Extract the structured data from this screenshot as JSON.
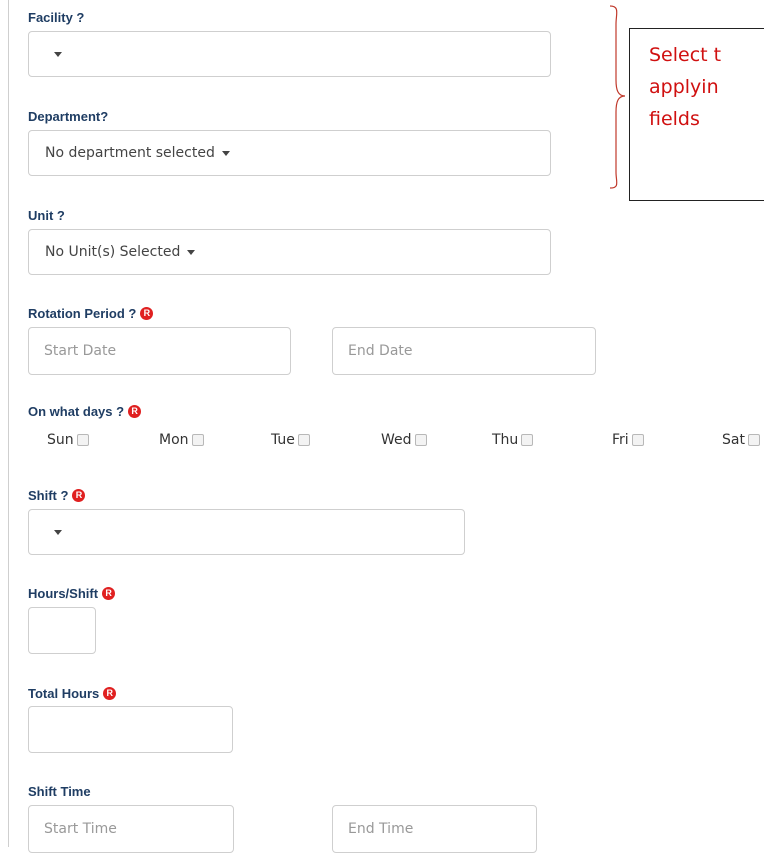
{
  "facility": {
    "label": "Facility ?",
    "selected": ""
  },
  "department": {
    "label": "Department?",
    "selected": "No department selected"
  },
  "unit": {
    "label": "Unit ?",
    "selected": "No Unit(s) Selected"
  },
  "rotation": {
    "label": "Rotation Period ?",
    "start_placeholder": "Start Date",
    "end_placeholder": "End Date"
  },
  "days": {
    "label": "On what days ?",
    "items": [
      {
        "label": "Sun",
        "checked": false
      },
      {
        "label": "Mon",
        "checked": false
      },
      {
        "label": "Tue",
        "checked": false
      },
      {
        "label": "Wed",
        "checked": false
      },
      {
        "label": "Thu",
        "checked": false
      },
      {
        "label": "Fri",
        "checked": false
      },
      {
        "label": "Sat",
        "checked": false
      }
    ]
  },
  "shift": {
    "label": "Shift ?",
    "selected": ""
  },
  "hours_shift": {
    "label": "Hours/Shift",
    "value": ""
  },
  "total_hours": {
    "label": "Total Hours",
    "value": ""
  },
  "shift_time": {
    "label": "Shift Time",
    "start_placeholder": "Start Time",
    "end_placeholder": "End Time"
  },
  "required_badge": "R",
  "annotation": {
    "lines": [
      "Select t",
      "applyin",
      "fields"
    ],
    "color": "#d01010"
  },
  "colors": {
    "label": "#1f3d63",
    "required": "#e02020",
    "border": "#cfcfcf"
  },
  "icons": {
    "dropdown": "caret-down-icon",
    "required": "required-icon",
    "brace": "curly-brace-icon"
  }
}
